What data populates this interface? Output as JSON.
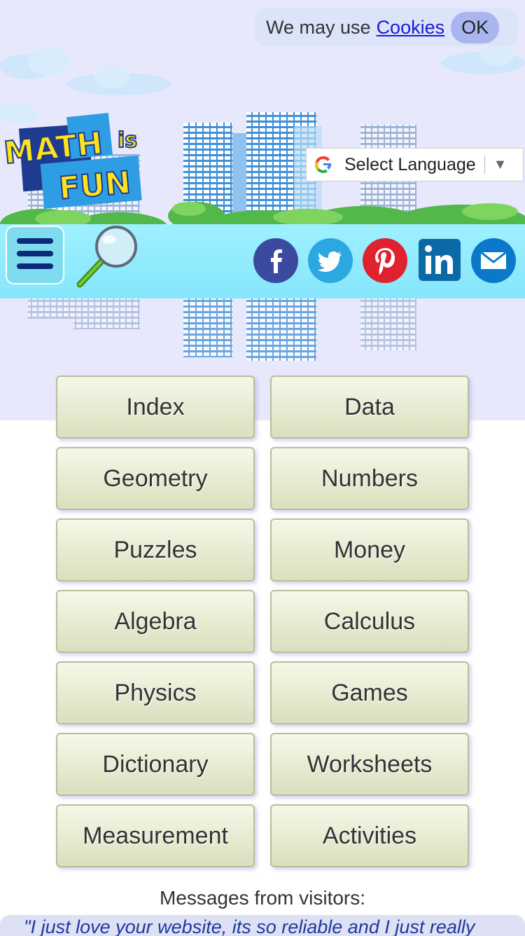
{
  "cookie_banner": {
    "text": "We may use",
    "link_label": "Cookies",
    "ok_label": "OK"
  },
  "site": {
    "logo_words": [
      "MATH",
      "is",
      "FUN"
    ]
  },
  "language_selector": {
    "label": "Select Language",
    "arrow": "▼"
  },
  "toolbar": {
    "menu_icon": "hamburger-menu-icon",
    "search_icon": "magnifier-icon"
  },
  "social": [
    {
      "name": "facebook",
      "glyph": "f",
      "color": "#3b4a9e"
    },
    {
      "name": "twitter",
      "glyph": "twitter-bird",
      "color": "#2da7e0"
    },
    {
      "name": "pinterest",
      "glyph": "p",
      "color": "#e0212f"
    },
    {
      "name": "linkedin",
      "glyph": "in",
      "color": "#0b6aa5"
    },
    {
      "name": "email",
      "glyph": "envelope",
      "color": "#0b78c9"
    }
  ],
  "nav": {
    "items": [
      "Index",
      "Data",
      "Geometry",
      "Numbers",
      "Puzzles",
      "Money",
      "Algebra",
      "Calculus",
      "Physics",
      "Games",
      "Dictionary",
      "Worksheets",
      "Measurement",
      "Activities"
    ]
  },
  "messages": {
    "title": "Messages from visitors:",
    "quote": "\"I just love your website, its so reliable and I just really"
  }
}
